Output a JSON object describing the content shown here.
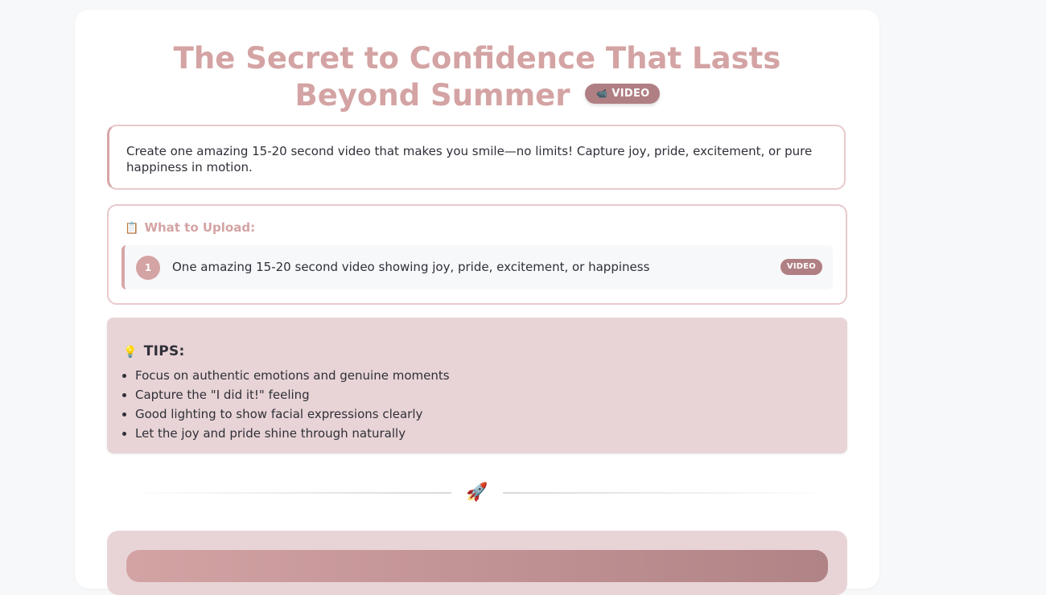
{
  "header": {
    "title": "The Secret to Confidence That Lasts Beyond Summer",
    "badge_icon": "📹",
    "badge_label": "VIDEO"
  },
  "description": "Create one amazing 15-20 second video that makes you smile—no limits! Capture joy, pride, excitement, or pure happiness in motion.",
  "upload": {
    "heading_icon": "📋",
    "heading": "What to Upload:",
    "items": [
      {
        "number": "1",
        "text": "One amazing 15-20 second video showing joy, pride, excitement, or happiness",
        "badge": "VIDEO"
      }
    ]
  },
  "tips": {
    "icon": "💡",
    "heading": "TIPS:",
    "items": [
      "Focus on authentic emotions and genuine moments",
      "Capture the \"I did it!\" feeling",
      "Good lighting to show facial expressions clearly",
      "Let the joy and pride shine through naturally"
    ]
  },
  "divider_icon": "🚀",
  "colors": {
    "accent": "#d4a3a3",
    "badge": "#b07f83",
    "tips_bg": "#e8d4d6",
    "text": "#2f2f38",
    "page_bg": "#f7f8fa"
  }
}
